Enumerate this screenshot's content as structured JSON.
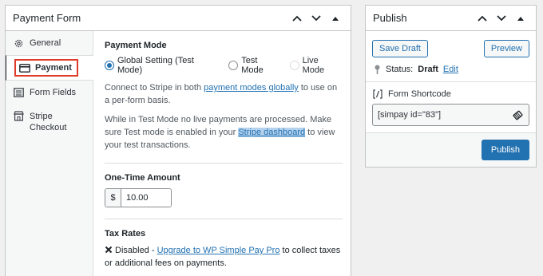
{
  "main_panel": {
    "title": "Payment Form",
    "tabs": [
      {
        "label": "General"
      },
      {
        "label": "Payment"
      },
      {
        "label": "Form Fields"
      },
      {
        "label": "Stripe Checkout"
      }
    ],
    "payment_mode": {
      "title": "Payment Mode",
      "options": [
        {
          "label": "Global Setting (Test Mode)",
          "selected": true
        },
        {
          "label": "Test Mode",
          "selected": false
        },
        {
          "label": "Live Mode",
          "selected": false
        }
      ],
      "desc1_a": "Connect to Stripe in both ",
      "desc1_link": "payment modes globally",
      "desc1_b": " to use on a per-form basis.",
      "desc2_a": "While in Test Mode no live payments are processed. Make sure Test mode is enabled in your ",
      "desc2_link": "Stripe dashboard",
      "desc2_b": " to view your test transactions."
    },
    "one_time_amount": {
      "title": "One-Time Amount",
      "currency": "$",
      "value": "10.00"
    },
    "tax_rates": {
      "title": "Tax Rates",
      "status": "Disabled - ",
      "link": "Upgrade to WP Simple Pay Pro",
      "suffix": " to collect taxes or additional fees on payments."
    }
  },
  "publish_panel": {
    "title": "Publish",
    "save_draft": "Save Draft",
    "preview": "Preview",
    "status_label": "Status:",
    "status_value": "Draft",
    "edit_link": "Edit",
    "shortcode_label": "Form Shortcode",
    "shortcode_value": "[simpay id=\"83\"]",
    "publish_button": "Publish"
  },
  "colors": {
    "accent": "#2271b1",
    "highlight_border": "#e03b2a"
  }
}
